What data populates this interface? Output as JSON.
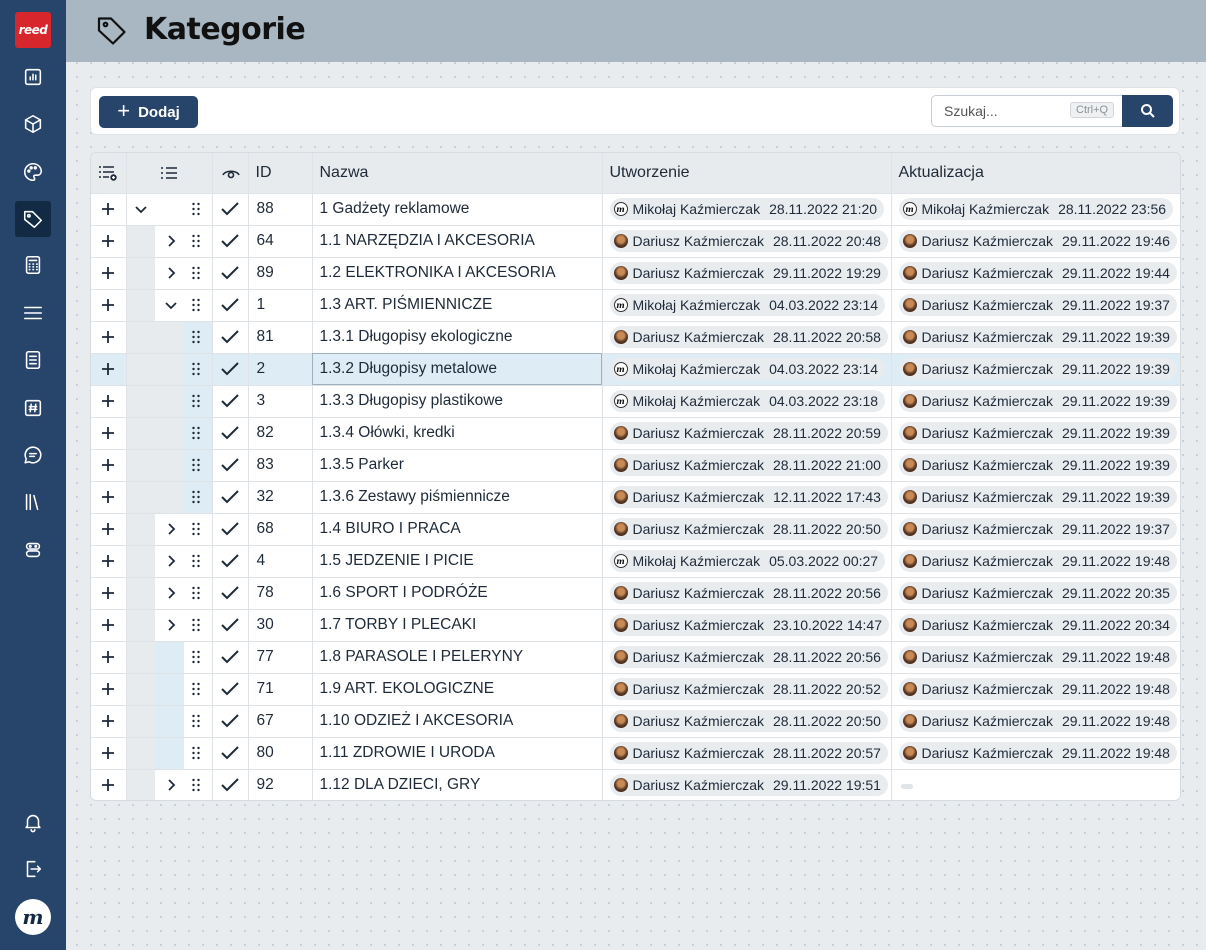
{
  "app": {
    "logo_text": "reed"
  },
  "sidebar": {
    "items": [
      {
        "icon": "chart-icon",
        "active": false
      },
      {
        "icon": "box-icon",
        "active": false
      },
      {
        "icon": "palette-icon",
        "active": false
      },
      {
        "icon": "tag-icon",
        "active": true
      },
      {
        "icon": "calculator-icon",
        "active": false
      },
      {
        "icon": "menu-icon",
        "active": false
      },
      {
        "icon": "document-icon",
        "active": false
      },
      {
        "icon": "hash-icon",
        "active": false
      },
      {
        "icon": "chat-icon",
        "active": false
      },
      {
        "icon": "library-icon",
        "active": false
      },
      {
        "icon": "robot-icon",
        "active": false
      }
    ],
    "bottom": [
      {
        "icon": "bell-icon"
      },
      {
        "icon": "logout-icon"
      }
    ],
    "avatar_text": "m"
  },
  "header": {
    "title": "Kategorie",
    "icon": "tag-icon"
  },
  "toolbar": {
    "add_label": "Dodaj",
    "search_placeholder": "Szukaj...",
    "search_shortcut": "Ctrl+Q"
  },
  "table": {
    "columns": {
      "id": "ID",
      "name": "Nazwa",
      "created": "Utworzenie",
      "updated": "Aktualizacja"
    },
    "rows": [
      {
        "id": "88",
        "name": "1 Gadżety reklamowe",
        "level": 0,
        "expander": "down",
        "cuser": "Mikołaj Kaźmierczak",
        "cdate": "28.11.2022 21:20",
        "cav": "logo",
        "uuser": "Mikołaj Kaźmierczak",
        "udate": "28.11.2022 23:56",
        "uav": "logo"
      },
      {
        "id": "64",
        "name": "1.1 NARZĘDZIA I AKCESORIA",
        "level": 1,
        "expander": "right",
        "cuser": "Dariusz Kaźmierczak",
        "cdate": "28.11.2022 20:48",
        "cav": "photo",
        "uuser": "Dariusz Kaźmierczak",
        "udate": "29.11.2022 19:46",
        "uav": "photo"
      },
      {
        "id": "89",
        "name": "1.2 ELEKTRONIKA I AKCESORIA",
        "level": 1,
        "expander": "right",
        "cuser": "Dariusz Kaźmierczak",
        "cdate": "29.11.2022 19:29",
        "cav": "photo",
        "uuser": "Dariusz Kaźmierczak",
        "udate": "29.11.2022 19:44",
        "uav": "photo"
      },
      {
        "id": "1",
        "name": "1.3 ART. PIŚMIENNICZE",
        "level": 1,
        "expander": "down",
        "cuser": "Mikołaj Kaźmierczak",
        "cdate": "04.03.2022 23:14",
        "cav": "logo",
        "uuser": "Dariusz Kaźmierczak",
        "udate": "29.11.2022 19:37",
        "uav": "photo"
      },
      {
        "id": "81",
        "name": "1.3.1 Długopisy ekologiczne",
        "level": 2,
        "expander": "none",
        "cuser": "Dariusz Kaźmierczak",
        "cdate": "28.11.2022 20:58",
        "cav": "photo",
        "uuser": "Dariusz Kaźmierczak",
        "udate": "29.11.2022 19:39",
        "uav": "photo"
      },
      {
        "id": "2",
        "name": "1.3.2 Długopisy metalowe",
        "level": 2,
        "expander": "none",
        "selected": true,
        "cuser": "Mikołaj Kaźmierczak",
        "cdate": "04.03.2022 23:14",
        "cav": "logo",
        "uuser": "Dariusz Kaźmierczak",
        "udate": "29.11.2022 19:39",
        "uav": "photo"
      },
      {
        "id": "3",
        "name": "1.3.3 Długopisy plastikowe",
        "level": 2,
        "expander": "none",
        "cuser": "Mikołaj Kaźmierczak",
        "cdate": "04.03.2022 23:18",
        "cav": "logo",
        "uuser": "Dariusz Kaźmierczak",
        "udate": "29.11.2022 19:39",
        "uav": "photo"
      },
      {
        "id": "82",
        "name": "1.3.4 Ołówki, kredki",
        "level": 2,
        "expander": "none",
        "cuser": "Dariusz Kaźmierczak",
        "cdate": "28.11.2022 20:59",
        "cav": "photo",
        "uuser": "Dariusz Kaźmierczak",
        "udate": "29.11.2022 19:39",
        "uav": "photo"
      },
      {
        "id": "83",
        "name": "1.3.5 Parker",
        "level": 2,
        "expander": "none",
        "cuser": "Dariusz Kaźmierczak",
        "cdate": "28.11.2022 21:00",
        "cav": "photo",
        "uuser": "Dariusz Kaźmierczak",
        "udate": "29.11.2022 19:39",
        "uav": "photo"
      },
      {
        "id": "32",
        "name": "1.3.6 Zestawy piśmiennicze",
        "level": 2,
        "expander": "none",
        "cuser": "Dariusz Kaźmierczak",
        "cdate": "12.11.2022 17:43",
        "cav": "photo",
        "uuser": "Dariusz Kaźmierczak",
        "udate": "29.11.2022 19:39",
        "uav": "photo"
      },
      {
        "id": "68",
        "name": "1.4 BIURO I PRACA",
        "level": 1,
        "expander": "right",
        "cuser": "Dariusz Kaźmierczak",
        "cdate": "28.11.2022 20:50",
        "cav": "photo",
        "uuser": "Dariusz Kaźmierczak",
        "udate": "29.11.2022 19:37",
        "uav": "photo"
      },
      {
        "id": "4",
        "name": "1.5 JEDZENIE I PICIE",
        "level": 1,
        "expander": "right",
        "cuser": "Mikołaj Kaźmierczak",
        "cdate": "05.03.2022 00:27",
        "cav": "logo",
        "uuser": "Dariusz Kaźmierczak",
        "udate": "29.11.2022 19:48",
        "uav": "photo"
      },
      {
        "id": "78",
        "name": "1.6 SPORT I PODRÓŻE",
        "level": 1,
        "expander": "right",
        "cuser": "Dariusz Kaźmierczak",
        "cdate": "28.11.2022 20:56",
        "cav": "photo",
        "uuser": "Dariusz Kaźmierczak",
        "udate": "29.11.2022 20:35",
        "uav": "photo"
      },
      {
        "id": "30",
        "name": "1.7 TORBY I PLECAKI",
        "level": 1,
        "expander": "right",
        "cuser": "Dariusz Kaźmierczak",
        "cdate": "23.10.2022 14:47",
        "cav": "photo",
        "uuser": "Dariusz Kaźmierczak",
        "udate": "29.11.2022 20:34",
        "uav": "photo"
      },
      {
        "id": "77",
        "name": "1.8 PARASOLE I PELERYNY",
        "level": 1,
        "expander": "none",
        "cuser": "Dariusz Kaźmierczak",
        "cdate": "28.11.2022 20:56",
        "cav": "photo",
        "uuser": "Dariusz Kaźmierczak",
        "udate": "29.11.2022 19:48",
        "uav": "photo"
      },
      {
        "id": "71",
        "name": "1.9 ART. EKOLOGICZNE",
        "level": 1,
        "expander": "none",
        "cuser": "Dariusz Kaźmierczak",
        "cdate": "28.11.2022 20:52",
        "cav": "photo",
        "uuser": "Dariusz Kaźmierczak",
        "udate": "29.11.2022 19:48",
        "uav": "photo"
      },
      {
        "id": "67",
        "name": "1.10 ODZIEŻ I AKCESORIA",
        "level": 1,
        "expander": "none",
        "cuser": "Dariusz Kaźmierczak",
        "cdate": "28.11.2022 20:50",
        "cav": "photo",
        "uuser": "Dariusz Kaźmierczak",
        "udate": "29.11.2022 19:48",
        "uav": "photo"
      },
      {
        "id": "80",
        "name": "1.11 ZDROWIE I URODA",
        "level": 1,
        "expander": "none",
        "cuser": "Dariusz Kaźmierczak",
        "cdate": "28.11.2022 20:57",
        "cav": "photo",
        "uuser": "Dariusz Kaźmierczak",
        "udate": "29.11.2022 19:48",
        "uav": "photo"
      },
      {
        "id": "92",
        "name": "1.12 DLA DZIECI, GRY",
        "level": 1,
        "expander": "right",
        "cuser": "Dariusz Kaźmierczak",
        "cdate": "29.11.2022 19:51",
        "cav": "photo",
        "uuser": "",
        "udate": "",
        "uav": "none"
      }
    ]
  }
}
